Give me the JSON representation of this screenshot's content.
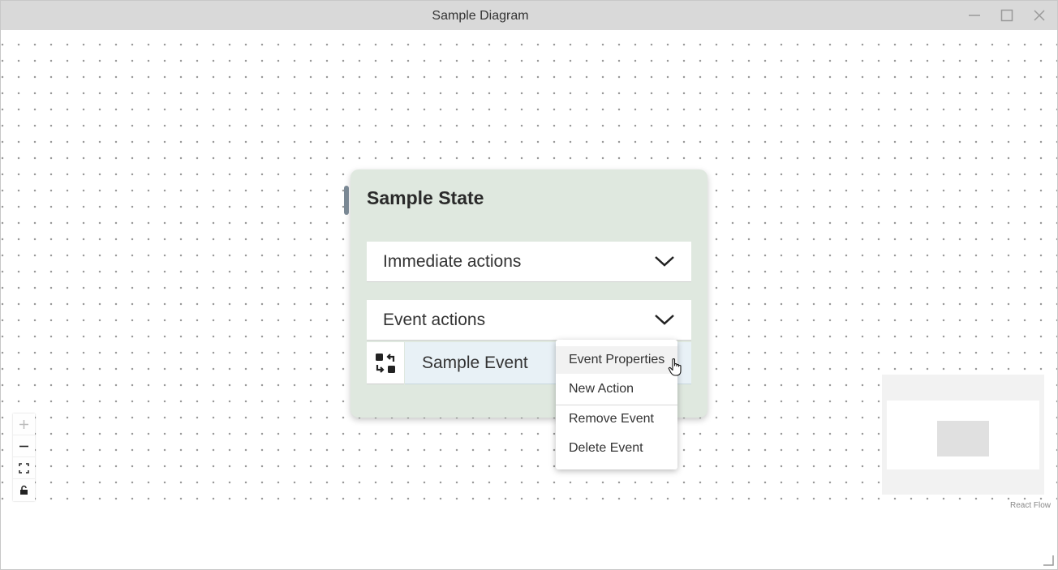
{
  "window": {
    "title": "Sample Diagram",
    "controls": [
      "minimize-icon",
      "maximize-icon",
      "close-icon"
    ]
  },
  "node": {
    "title": "Sample State",
    "sections": [
      {
        "label": "Immediate actions",
        "icon": "chevron-down-icon"
      },
      {
        "label": "Event actions",
        "icon": "chevron-down-icon"
      }
    ],
    "event": {
      "name": "Sample Event",
      "icon": "swap-icon"
    }
  },
  "context_menu": {
    "items": [
      "Event Properties",
      "New Action",
      "Remove Event",
      "Delete Event"
    ],
    "hovered": "Event Properties"
  },
  "canvas_controls": [
    "zoom-in-icon",
    "zoom-out-icon",
    "fit-view-icon",
    "lock-icon"
  ],
  "attribution": "React Flow",
  "colors": {
    "titlebar": "#d9d9d9",
    "node_bg": "#dfe8df",
    "event_bg": "#e8f1f6",
    "handle": "#7a8894"
  }
}
